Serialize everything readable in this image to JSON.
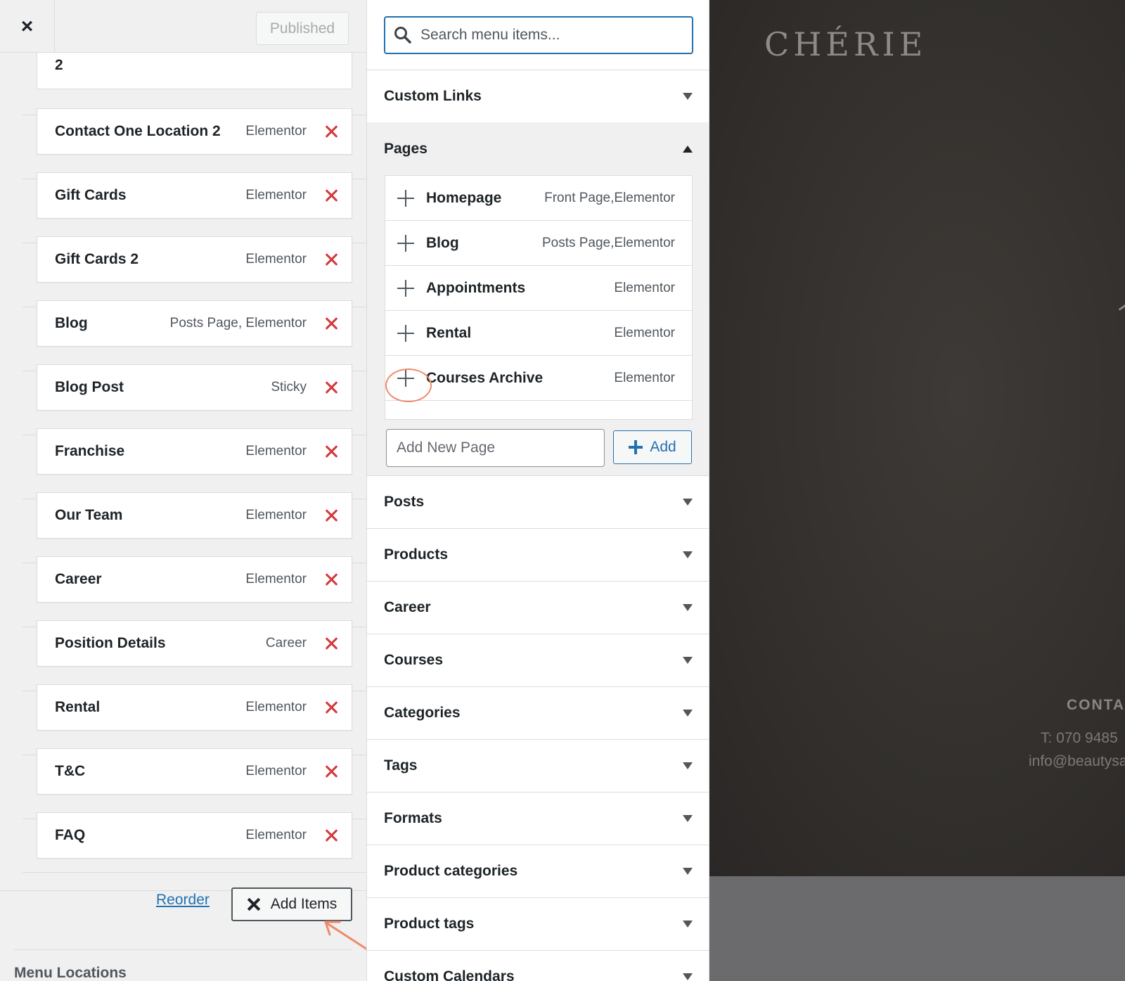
{
  "header": {
    "close_label": "×",
    "published_label": "Published"
  },
  "menu": {
    "partial_item_title": "2",
    "items": [
      {
        "title": "Contact One Location 2",
        "type": "Elementor"
      },
      {
        "title": "Gift Cards",
        "type": "Elementor"
      },
      {
        "title": "Gift Cards 2",
        "type": "Elementor"
      },
      {
        "title": "Blog",
        "type": "Posts Page, Elementor"
      },
      {
        "title": "Blog Post",
        "type": "Sticky"
      },
      {
        "title": "Franchise",
        "type": "Elementor"
      },
      {
        "title": "Our Team",
        "type": "Elementor"
      },
      {
        "title": "Career",
        "type": "Elementor"
      },
      {
        "title": "Position Details",
        "type": "Career"
      },
      {
        "title": "Rental",
        "type": "Elementor"
      },
      {
        "title": "T&C",
        "type": "Elementor"
      },
      {
        "title": "FAQ",
        "type": "Elementor"
      }
    ],
    "reorder_label": "Reorder",
    "add_items_label": "Add Items",
    "locations_label": "Menu Locations"
  },
  "search": {
    "placeholder": "Search menu items..."
  },
  "sections": {
    "custom_links": "Custom Links",
    "pages": "Pages",
    "rest": [
      "Posts",
      "Products",
      "Career",
      "Courses",
      "Categories",
      "Tags",
      "Formats",
      "Product categories",
      "Product tags",
      "Custom Calendars"
    ]
  },
  "pages": {
    "items": [
      {
        "title": "Homepage",
        "type": "Front Page,Elementor"
      },
      {
        "title": "Blog",
        "type": "Posts Page,Elementor"
      },
      {
        "title": "Appointments",
        "type": "Elementor"
      },
      {
        "title": "Rental",
        "type": "Elementor"
      },
      {
        "title": "Courses Archive",
        "type": "Elementor"
      }
    ],
    "new_page_placeholder": "Add New Page",
    "add_label": "Add"
  },
  "preview": {
    "brand": "CHÉRIE",
    "contact_heading": "CONTA",
    "phone": "T: 070 9485",
    "email": "info@beautysa"
  },
  "colors": {
    "accent": "#2271b1",
    "remove": "#d63638",
    "annotation": "#f08a6a"
  }
}
